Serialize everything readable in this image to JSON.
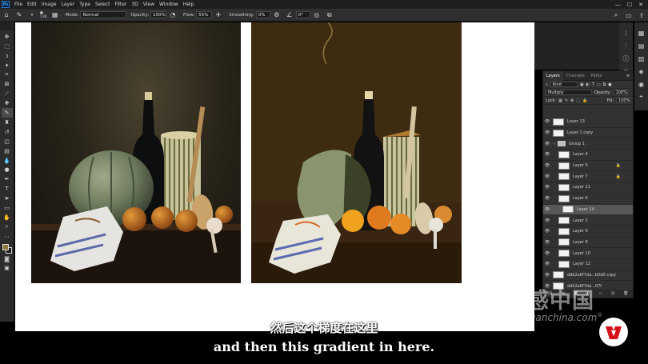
{
  "app": {
    "logo_text": "Ps"
  },
  "menu": [
    "File",
    "Edit",
    "Image",
    "Layer",
    "Type",
    "Select",
    "Filter",
    "3D",
    "View",
    "Window",
    "Help"
  ],
  "window_controls": [
    "—",
    "☐",
    "✕"
  ],
  "options": {
    "brush_size": "136",
    "mode_label": "Mode:",
    "mode_value": "Normal",
    "opacity_label": "Opacity:",
    "opacity_value": "100%",
    "flow_label": "Flow:",
    "flow_value": "55%",
    "smoothing_label": "Smoothing:",
    "smoothing_value": "0%",
    "angle_value": "0°"
  },
  "layers_panel": {
    "tabs": [
      "Layers",
      "Channels",
      "Paths"
    ],
    "active_tab": "Layers",
    "filter_value": "Kind",
    "blend_mode": "Multiply",
    "opacity_label": "Opacity:",
    "opacity_value": "100%",
    "lock_label": "Lock:",
    "fill_label": "Fill:",
    "fill_value": "100%",
    "layers": [
      {
        "name": "Layer 13",
        "type": "layer"
      },
      {
        "name": "Layer 1 copy",
        "type": "layer"
      },
      {
        "name": "Group 1",
        "type": "group"
      },
      {
        "name": "Layer 4",
        "type": "layer",
        "indent": 1
      },
      {
        "name": "Layer 5",
        "type": "layer",
        "indent": 1,
        "locked": true
      },
      {
        "name": "Layer 7",
        "type": "layer",
        "indent": 1,
        "locked": true
      },
      {
        "name": "Layer 11",
        "type": "layer",
        "indent": 1
      },
      {
        "name": "Layer 6",
        "type": "layer",
        "indent": 1
      },
      {
        "name": "Layer 14",
        "type": "layer",
        "indent": 2,
        "selected": true
      },
      {
        "name": "Layer 2",
        "type": "layer",
        "indent": 1
      },
      {
        "name": "Layer 9",
        "type": "layer",
        "indent": 1
      },
      {
        "name": "Layer 8",
        "type": "layer",
        "indent": 1
      },
      {
        "name": "Layer 10",
        "type": "layer",
        "indent": 1
      },
      {
        "name": "Layer 12",
        "type": "layer",
        "indent": 1
      },
      {
        "name": "ddb2a6f7da...b5d0 copy",
        "type": "layer"
      },
      {
        "name": "ddb2a6f7da...07f",
        "type": "layer"
      }
    ]
  },
  "subtitles": {
    "chinese": "然后这个梯度在这里",
    "english": "and then this gradient in here."
  },
  "watermark": {
    "chinese": "灵感中国",
    "domain": "lingganchina.com",
    "registered": "®"
  },
  "colors": {
    "accent": "#31a8ff",
    "canvas_bg": "#ffffff",
    "flat_bg": "#3e2c12",
    "badge_red": "#d6121a"
  }
}
